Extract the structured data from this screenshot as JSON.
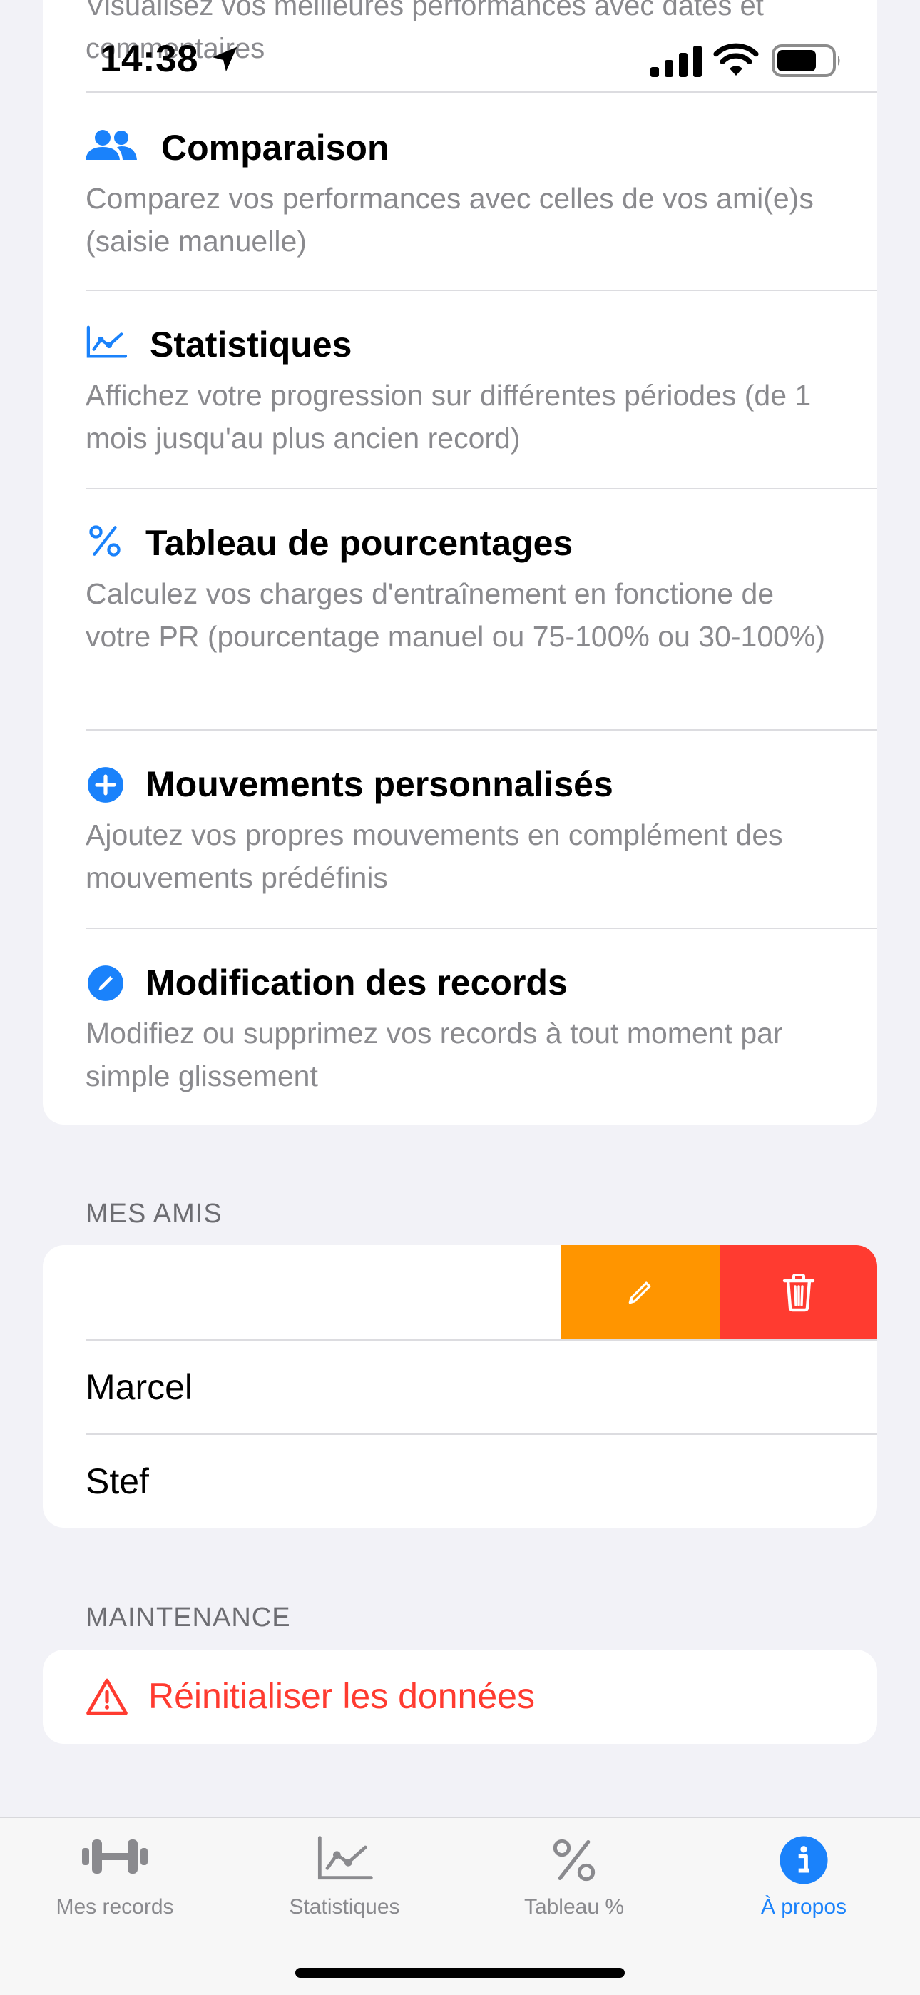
{
  "status_bar": {
    "peek_text": "Visualisez vos meilleures performances avec dates et commentaires",
    "time": "14:38"
  },
  "features": [
    {
      "icon": "people-icon",
      "title": "Comparaison",
      "desc": "Comparez vos performances avec celles de vos ami(e)s (saisie manuelle)"
    },
    {
      "icon": "chart-line-icon",
      "title": "Statistiques",
      "desc": "Affichez votre progression sur différentes périodes (de 1 mois jusqu'au plus ancien record)"
    },
    {
      "icon": "percent-icon",
      "title": "Tableau de pourcentages",
      "desc": "Calculez vos charges d'entraînement en fonctione de votre PR (pourcentage manuel ou 75-100% ou 30-100%)"
    },
    {
      "icon": "plus-circle-icon",
      "title": "Mouvements personnalisés",
      "desc": "Ajoutez vos propres mouvements en complément des mouvements prédéfinis"
    },
    {
      "icon": "pencil-circle-icon",
      "title": "Modification des records",
      "desc": "Modifiez ou supprimez vos records à tout moment par simple glissement"
    }
  ],
  "friends": {
    "header": "MES AMIS",
    "items": [
      "Marcel",
      "Stef"
    ]
  },
  "maintenance": {
    "header": "MAINTENANCE",
    "reset_label": "Réinitialiser les données"
  },
  "tabs": [
    {
      "label": "Mes records",
      "icon": "dumbbell-icon",
      "active": false
    },
    {
      "label": "Statistiques",
      "icon": "chart-line-icon",
      "active": false
    },
    {
      "label": "Tableau %",
      "icon": "percent-icon",
      "active": false
    },
    {
      "label": "À propos",
      "icon": "info-circle-icon",
      "active": true
    }
  ],
  "colors": {
    "accent": "#1a82fb",
    "destructive": "#ff3b30",
    "edit": "#ff9500",
    "secondary_text": "#8a8a8e",
    "background": "#f2f2f7"
  }
}
